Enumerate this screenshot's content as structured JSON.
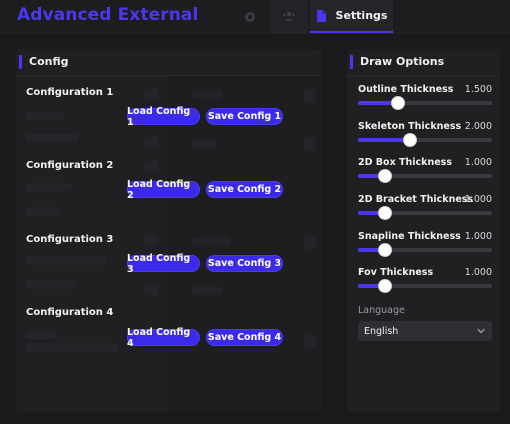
{
  "app": {
    "title": "Advanced External"
  },
  "tabs": {
    "visuals_icon": "eye-icon",
    "players_icon": "users-icon",
    "settings_icon": "document-icon",
    "settings_label": "Settings"
  },
  "config": {
    "title": "Config",
    "rows": [
      {
        "label": "Configuration 1",
        "load": "Load Config 1",
        "save": "Save Config 1"
      },
      {
        "label": "Configuration 2",
        "load": "Load Config 2",
        "save": "Save Config 2"
      },
      {
        "label": "Configuration 3",
        "load": "Load Config 3",
        "save": "Save Config 3"
      },
      {
        "label": "Configuration 4",
        "load": "Load Config 4",
        "save": "Save Config 4"
      }
    ]
  },
  "draw": {
    "title": "Draw Options",
    "sliders": [
      {
        "label": "Outline Thickness",
        "value": "1.500",
        "fraction": 0.3
      },
      {
        "label": "Skeleton Thickness",
        "value": "2.000",
        "fraction": 0.39
      },
      {
        "label": "2D Box Thickness",
        "value": "1.000",
        "fraction": 0.2
      },
      {
        "label": "2D Bracket Thickness",
        "value": "1.000",
        "fraction": 0.2
      },
      {
        "label": "Snapline Thickness",
        "value": "1.000",
        "fraction": 0.2
      },
      {
        "label": "Fov Thickness",
        "value": "1.000",
        "fraction": 0.2
      }
    ],
    "language_label": "Language",
    "language_value": "English"
  },
  "colors": {
    "accent": "#4b37f0",
    "button": "#3b2ae8",
    "panel": "#202023",
    "background": "#1a1a1c"
  }
}
